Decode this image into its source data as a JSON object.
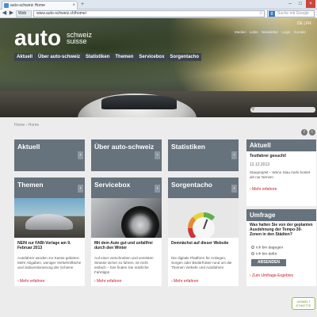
{
  "browser": {
    "tab_title": "auto-schweiz Home",
    "web_button": "Web",
    "url": "www.auto-schweiz.ch/home/",
    "search_placeholder": "Suche mit Google"
  },
  "header": {
    "logo_main": "auto",
    "logo_sub1": "schweiz",
    "logo_sub2": "suisse",
    "lang": "DE | FR",
    "meta_links": [
      "Medien",
      "Links",
      "Newsletter",
      "Login",
      "Kontakt"
    ],
    "nav": [
      "Aktuell",
      "Über auto-schweiz",
      "Statistiken",
      "Themen",
      "Servicebox",
      "Sorgentacho"
    ]
  },
  "breadcrumb": "Home  ›  Home",
  "tiles": [
    {
      "title": "Aktuell"
    },
    {
      "title": "Über auto-schweiz"
    },
    {
      "title": "Statistiken"
    }
  ],
  "cards": [
    {
      "title": "Themen",
      "headline": "NEIN zur FABI-Vorlage am 9. Februar 2013",
      "text": "Autofahrer werden zur Kasse gebeten: Mehr Abgaben, weniger Verkehrsfläche und Subventionierung der Schiene",
      "more": "› Mehr erfahren"
    },
    {
      "title": "Servicebox",
      "headline": "Mit dem Auto gut und unfallfrei durch den Winter",
      "text": "Auf einer verschneiten und vereisten Strasse sicher zu fahren, ist nicht einfach – hier finden Sie nützliche Fahrtipps",
      "more": "› Mehr erfahren"
    },
    {
      "title": "Sorgentacho",
      "headline": "Demnächst auf dieser Website",
      "text": "Die digitale Plattform für Anliegen, Sorgen oder Bedürfnisse rund um die Themen Verkehr und Autofahren",
      "more": "› Mehr erfahren"
    }
  ],
  "sidebar": {
    "aktuell": {
      "heading": "Aktuell",
      "subtitle": "Testfahrer gesucht!",
      "date": "12.12.2013",
      "text": "Stauprojekt – Wenn Stau mehr kostet als nur Nerven",
      "more": "› Mehr erfahren"
    },
    "umfrage": {
      "heading": "Umfrage",
      "question": "Was halten Sie von der geplanten Ausdehnung der Tempo-30-Zonen in den Städten?",
      "options": [
        "Ich bin dagegen",
        "Ich bin dafür"
      ],
      "submit": "ABSENDEN",
      "result_link": "› Zum Umfrage-Ergebnis"
    }
  },
  "badge": "UMWELT ETIKETTE"
}
